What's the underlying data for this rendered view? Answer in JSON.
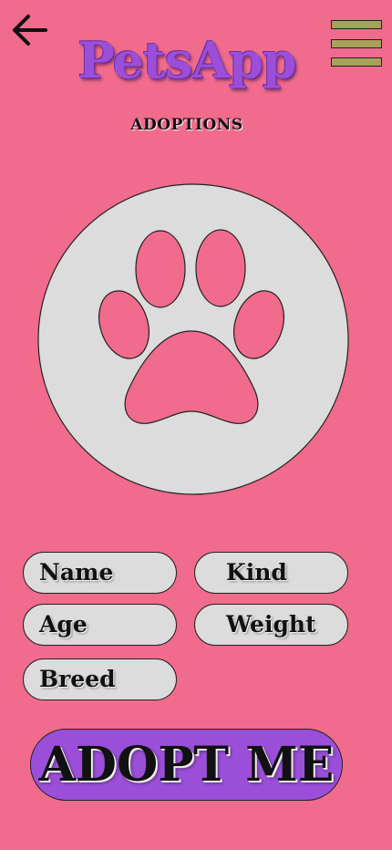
{
  "header": {
    "back_icon": "arrow-left-icon",
    "menu_icon": "hamburger-menu-icon",
    "title": "PetsApp",
    "subtitle": "ADOPTIONS"
  },
  "colors": {
    "background": "#f06b8c",
    "brand": "#9b4fd9",
    "field_bg": "#dcdcdc",
    "menu_bar": "#a8a15a"
  },
  "pet": {
    "image_icon": "paw-print-icon"
  },
  "fields": {
    "name": "Name",
    "kind": "Kind",
    "age": "Age",
    "weight": "Weight",
    "breed": "Breed"
  },
  "actions": {
    "adopt_label": "ADOPT ME"
  }
}
